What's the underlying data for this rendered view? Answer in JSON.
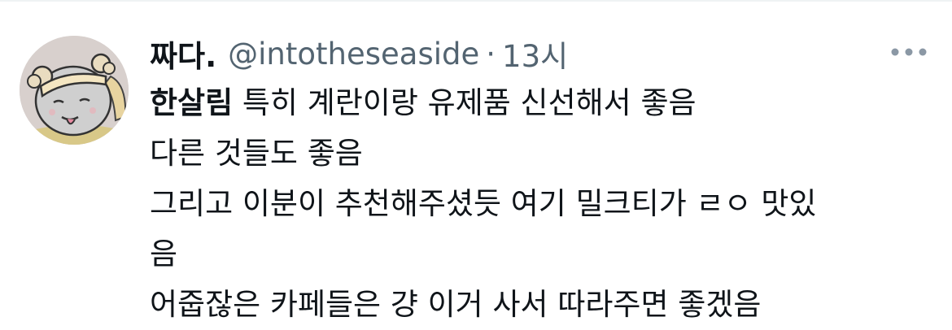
{
  "tweet": {
    "author": {
      "display_name": "짜다.",
      "handle": "@intotheseaside"
    },
    "separator": "·",
    "timestamp": "13시",
    "more_icon": "more-horizontal-icon",
    "text": {
      "line1_bold": "한살림",
      "line1_rest": " 특히 계란이랑 유제품 신선해서 좋음",
      "line2": "다른 것들도 좋음",
      "line3": "그리고 이분이 추천해주셨듯 여기 밀크티가 ㄹㅇ 맛있",
      "line4": "음",
      "line5": "어줍잖은 카페들은 걍 이거 사서 따라주면 좋겠음"
    }
  },
  "colors": {
    "text": "#0f1419",
    "secondary": "#536471",
    "avatar_bg": "#d9d2cf",
    "divider": "#eff3f4"
  }
}
